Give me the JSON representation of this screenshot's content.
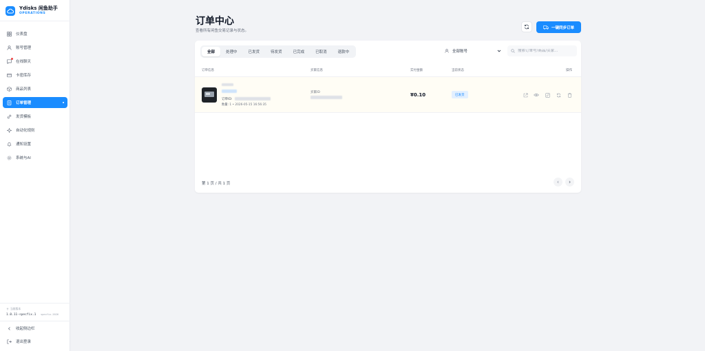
{
  "brand": {
    "title": "Ydisks 闲鱼助手",
    "subtitle": "OPERATIONS",
    "accent": "#1a8cff"
  },
  "sidebar": {
    "items": [
      {
        "label": "仪表盘",
        "icon": "dashboard-icon",
        "active": false
      },
      {
        "label": "账号管理",
        "icon": "user-icon",
        "active": false
      },
      {
        "label": "在线聊天",
        "icon": "chat-icon",
        "active": false,
        "badge": true
      },
      {
        "label": "卡密库存",
        "icon": "card-icon",
        "active": false
      },
      {
        "label": "商品列表",
        "icon": "box-icon",
        "active": false
      },
      {
        "label": "订单管理",
        "icon": "order-icon",
        "active": true
      },
      {
        "label": "发货模板",
        "icon": "link-icon",
        "active": false
      },
      {
        "label": "自动化规则",
        "icon": "spark-icon",
        "active": false
      },
      {
        "label": "通知设置",
        "icon": "bell-icon",
        "active": false
      },
      {
        "label": "系统与AI",
        "icon": "gear-icon",
        "active": false
      }
    ],
    "version_label": "当前版本",
    "version_value": "1.0.11-specfix.1",
    "version_extra": "specfix-2026",
    "collapse_label": "收起侧边栏",
    "logout_label": "退出登录"
  },
  "header": {
    "title": "订单中心",
    "subtitle": "查看所有闲鱼交易记录与状态。",
    "primary_button": "一键同步订单"
  },
  "filters": {
    "tabs": [
      "全部",
      "处理中",
      "已发货",
      "待发货",
      "已完成",
      "已取消",
      "退款中"
    ],
    "active_tab": 0,
    "account_select": "全部账号",
    "search_placeholder": "搜索订单号/商品/买家..."
  },
  "table": {
    "columns": [
      "订单信息",
      "买家信息",
      "实付金额",
      "当前状态",
      "操作"
    ],
    "rows": [
      {
        "order_id_label": "订单ID:",
        "meta": "数量: 1 • 2026-05-15 16:56:35",
        "buyer_label": "买家ID",
        "amount": "¥0.10",
        "status": "已发货"
      }
    ]
  },
  "pagination": {
    "text": "第 1 页 / 共 1 页"
  }
}
